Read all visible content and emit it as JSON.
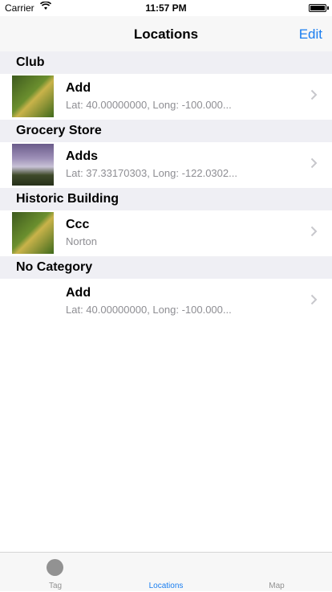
{
  "status_bar": {
    "carrier": "Carrier",
    "time": "11:57 PM"
  },
  "navbar": {
    "title": "Locations",
    "edit_label": "Edit"
  },
  "sections": [
    {
      "header": "Club",
      "rows": [
        {
          "name": "Add",
          "detail": "Lat: 40.00000000, Long: -100.000...",
          "thumbnail": "leaf-photo"
        }
      ]
    },
    {
      "header": "Grocery Store",
      "rows": [
        {
          "name": "Adds",
          "detail": "Lat: 37.33170303, Long: -122.0302...",
          "thumbnail": "waterfall-photo"
        }
      ]
    },
    {
      "header": "Historic Building",
      "rows": [
        {
          "name": "Ccc",
          "detail": "Norton",
          "thumbnail": "leaf-photo"
        }
      ]
    },
    {
      "header": "No Category",
      "rows": [
        {
          "name": "Add",
          "detail": "Lat: 40.00000000, Long: -100.000...",
          "thumbnail": "none"
        }
      ]
    }
  ],
  "tabbar": {
    "tabs": [
      {
        "label": "Tag",
        "icon": "circle-icon",
        "active": false
      },
      {
        "label": "Locations",
        "active": true
      },
      {
        "label": "Map",
        "active": false
      }
    ]
  },
  "colors": {
    "accent": "#1a7ef0",
    "section_bg": "#efeff4",
    "secondary_text": "#8e8e93"
  }
}
